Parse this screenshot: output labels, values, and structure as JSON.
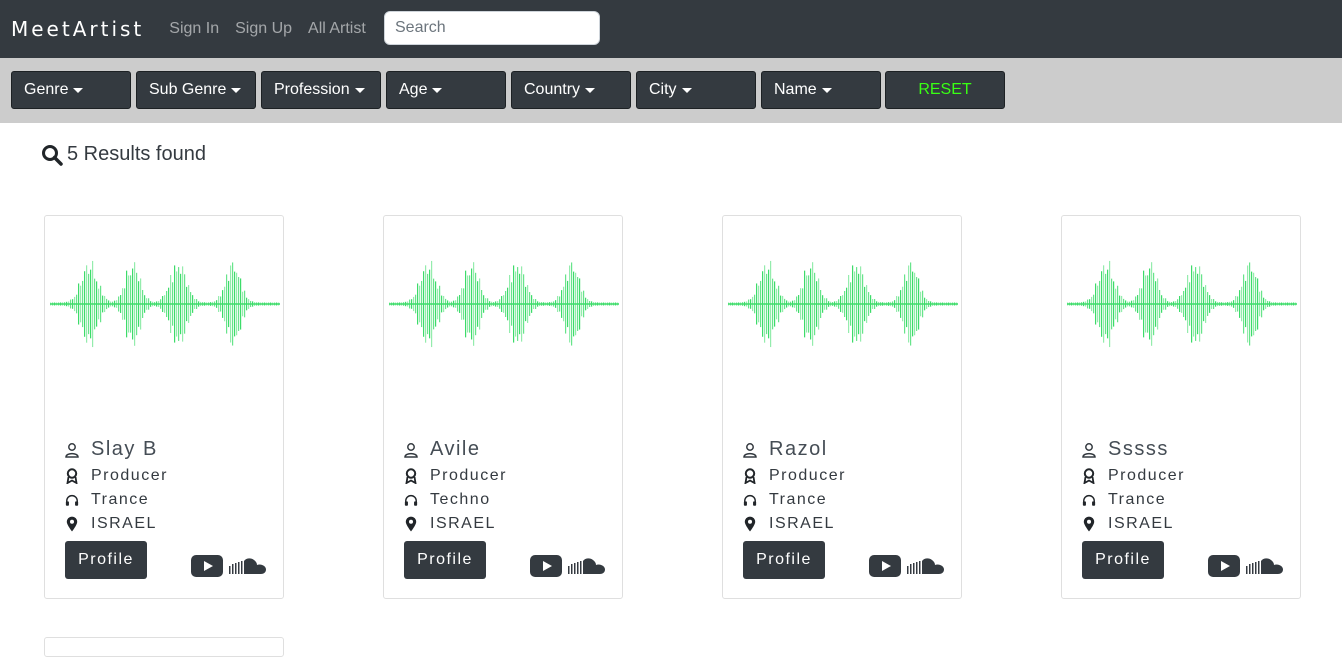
{
  "navbar": {
    "brand": "MeetArtist",
    "links": [
      "Sign In",
      "Sign Up",
      "All Artist"
    ],
    "search_placeholder": "Search"
  },
  "filters": {
    "buttons": [
      "Genre",
      "Sub Genre",
      "Profession",
      "Age",
      "Country",
      "City",
      "Name"
    ],
    "reset_label": "RESET",
    "reset_color": "#39ff14"
  },
  "results": {
    "text": "5 Results found",
    "icon": "search-icon"
  },
  "cards": [
    {
      "name": "Slay B",
      "profession": "Producer",
      "genre": "Trance",
      "country": "ISRAEL",
      "button": "Profile"
    },
    {
      "name": "Avile",
      "profession": "Producer",
      "genre": "Techno",
      "country": "ISRAEL",
      "button": "Profile"
    },
    {
      "name": "Razol",
      "profession": "Producer",
      "genre": "Trance",
      "country": "ISRAEL",
      "button": "Profile"
    },
    {
      "name": "Sssss",
      "profession": "Producer",
      "genre": "Trance",
      "country": "ISRAEL",
      "button": "Profile"
    }
  ],
  "card_icons": [
    "user-icon",
    "award-icon",
    "headphones-icon",
    "map-marker-icon",
    "youtube-icon",
    "soundcloud-icon",
    "soundwave-image"
  ],
  "colors": {
    "navbar": "#343a40",
    "filterbar": "#cccccc",
    "wave": "#3ddc6a"
  }
}
